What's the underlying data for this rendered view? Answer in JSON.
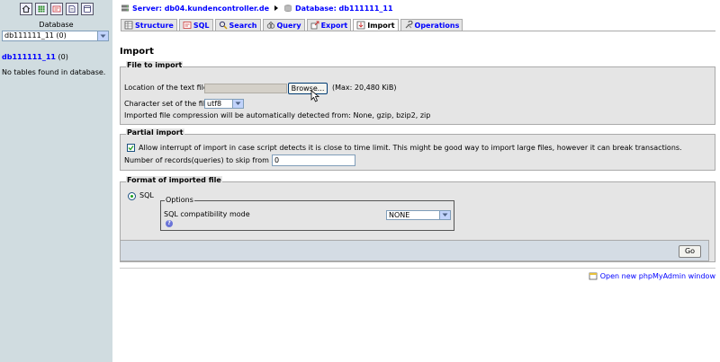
{
  "sidebar": {
    "icons": [
      "home-icon",
      "database-icon",
      "sql-icon",
      "docs-icon",
      "query-window-icon"
    ],
    "database_label": "Database",
    "database_select": "db111111_11 (0)",
    "db_link": "db111111_11",
    "db_count": "(0)",
    "no_tables": "No tables found in database."
  },
  "breadcrumb": {
    "server": "Server: db04.kundencontroller.de",
    "database": "Database: db111111_11"
  },
  "tabs": [
    {
      "label": "Structure",
      "icon": "structure-icon",
      "active": false
    },
    {
      "label": "SQL",
      "icon": "sql-icon",
      "active": false
    },
    {
      "label": "Search",
      "icon": "search-icon",
      "active": false
    },
    {
      "label": "Query",
      "icon": "query-icon",
      "active": false
    },
    {
      "label": "Export",
      "icon": "export-icon",
      "active": false
    },
    {
      "label": "Import",
      "icon": "import-icon",
      "active": true
    },
    {
      "label": "Operations",
      "icon": "operations-icon",
      "active": false
    }
  ],
  "page_title": "Import",
  "file_to_import": {
    "legend": "File to import",
    "location_label": "Location of the text file",
    "browse_label": "Browse...",
    "max_label": "(Max: 20,480 KiB)",
    "charset_label": "Character set of the file:",
    "charset_value": "utf8",
    "compression_note": "Imported file compression will be automatically detected from: None, gzip, bzip2, zip"
  },
  "partial_import": {
    "legend": "Partial import",
    "allow_interrupt_label": "Allow interrupt of import in case script detects it is close to time limit. This might be good way to import large files, however it can break transactions.",
    "allow_interrupt_checked": true,
    "skip_label": "Number of records(queries) to skip from start",
    "skip_value": "0"
  },
  "format": {
    "legend": "Format of imported file",
    "sql_option": "SQL",
    "options_legend": "Options",
    "compat_label": "SQL compatibility mode",
    "compat_value": "NONE",
    "help_glyph": "?"
  },
  "go_label": "Go",
  "new_window_link": "Open new phpMyAdmin window",
  "colors": {
    "sidebar_bg": "#d0dce0",
    "fieldset_bg": "#e5e5e5",
    "link": "#0000ff"
  }
}
